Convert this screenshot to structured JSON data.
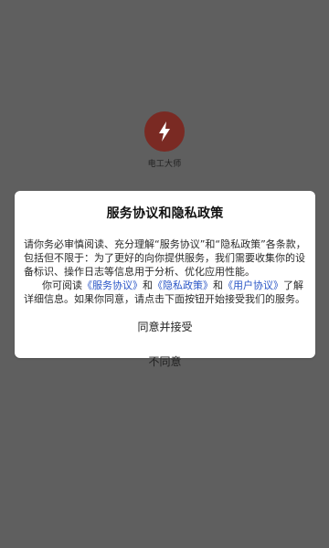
{
  "app": {
    "name": "电工大师",
    "logo_icon": "lightning-bolt-icon",
    "logo_color": "#7a2a23"
  },
  "dialog": {
    "title": "服务协议和隐私政策",
    "paragraph1": "请你务必审慎阅读、充分理解“服务协议”和“隐私政策”各条款，包括但不限于：为了更好的向你提供服务，我们需要收集你的设备标识、操作日志等信息用于分析、优化应用性能。",
    "paragraph2": {
      "intro": "你可阅读",
      "link1": "《服务协议》",
      "and1": "和",
      "link2": "《隐私政策》",
      "and2": "和",
      "link3": "《用户协议》",
      "tail": "了解详细信息。如果你同意，请点击下面按钮开始接受我们的服务。"
    },
    "agree_button": "同意并接受",
    "disagree_button": "不同意",
    "link_color": "#2a56c6"
  }
}
